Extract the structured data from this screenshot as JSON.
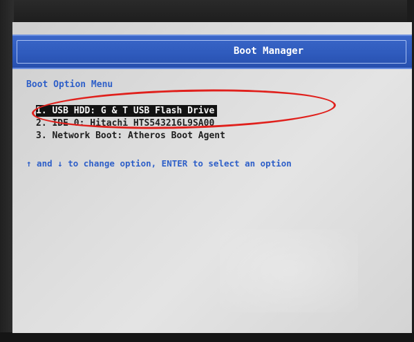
{
  "window": {
    "title": "Boot Manager"
  },
  "menu": {
    "heading": "Boot Option Menu",
    "options": [
      {
        "label": "1. USB HDD: G & T   USB Flash Drive",
        "selected": true
      },
      {
        "label": "2. IDE 0: Hitachi HTS543216L9SA00",
        "selected": false
      },
      {
        "label": "3. Network Boot: Atheros Boot Agent",
        "selected": false
      }
    ]
  },
  "hint": {
    "text": "↑ and ↓ to change option, ENTER to select an option"
  },
  "colors": {
    "title_bar": "#2f5bbd",
    "heading_text": "#2e5fc8",
    "selection_bg": "#121212",
    "annotation_ring": "#e0201c"
  }
}
